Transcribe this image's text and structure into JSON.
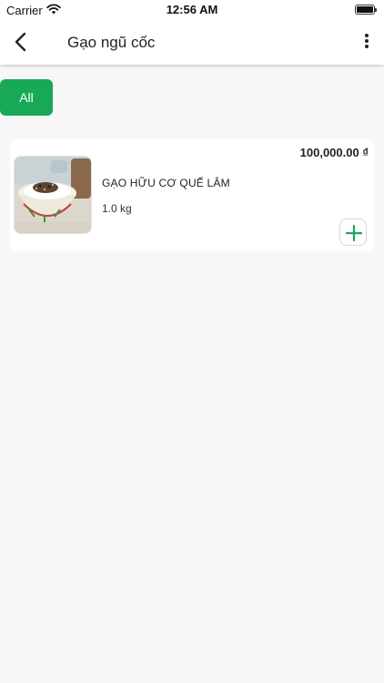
{
  "status_bar": {
    "carrier": "Carrier",
    "time": "12:56 AM"
  },
  "nav": {
    "title": "Gạo ngũ cốc",
    "icons": [
      "back-icon",
      "more-vertical-icon"
    ]
  },
  "filter": {
    "chips": [
      {
        "label": "All",
        "selected": true
      }
    ]
  },
  "products": [
    {
      "price": "100,000.00 ₫",
      "name": "GẠO HỮU CƠ QUẾ LÂM",
      "weight": "1.0 kg",
      "image": "rice-bowl-image"
    }
  ],
  "colors": {
    "accent": "#18a957",
    "background": "#f7f7f7",
    "card": "#ffffff"
  }
}
